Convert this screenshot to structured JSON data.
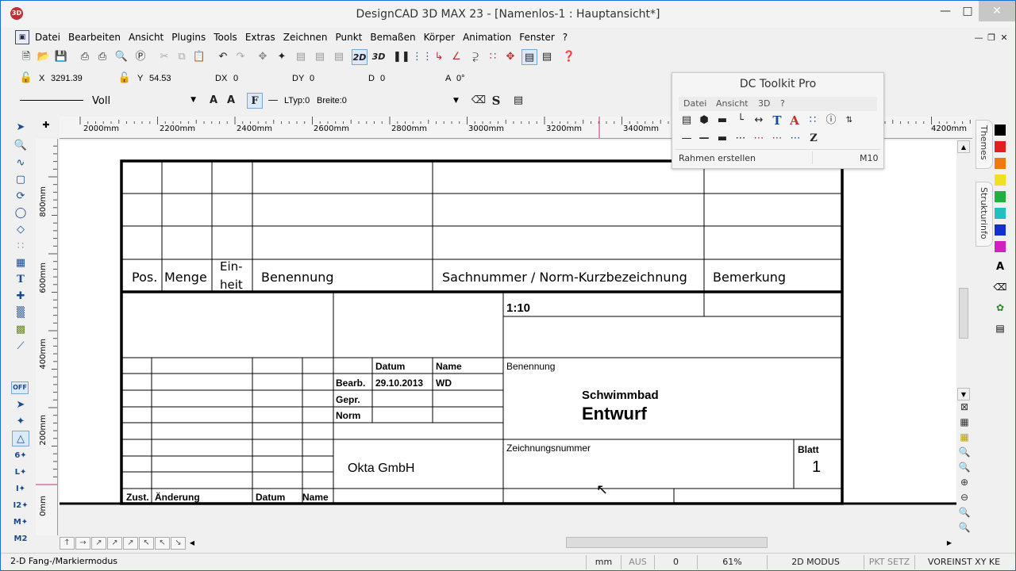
{
  "window": {
    "title": "DesignCAD 3D MAX 23 - [Namenlos-1 : Hauptansicht*]",
    "app_icon": "3D"
  },
  "menu": [
    "Datei",
    "Bearbeiten",
    "Ansicht",
    "Plugins",
    "Tools",
    "Extras",
    "Zeichnen",
    "Punkt",
    "Bemaßen",
    "Körper",
    "Animation",
    "Fenster",
    "?"
  ],
  "toolbar": {
    "btn_2d": "2D",
    "btn_3d": "3D"
  },
  "coords": {
    "x_label": "X",
    "x_value": "3291.39",
    "y_label": "Y",
    "y_value": "54.53",
    "dx_label": "DX",
    "dx_value": "0",
    "dy_label": "DY",
    "dy_value": "0",
    "d_label": "D",
    "d_value": "0",
    "a_label": "A",
    "a_value": "0°"
  },
  "linebar": {
    "line_style": "Voll",
    "font_btn": "F",
    "ltyp": "LTyp:0",
    "breite": "Breite:0"
  },
  "ruler_h": [
    "2000mm",
    "2200mm",
    "2400mm",
    "2600mm",
    "2800mm",
    "3000mm",
    "3200mm",
    "3400mm",
    "4200mm"
  ],
  "ruler_v": [
    "800mm",
    "600mm",
    "400mm",
    "200mm",
    "0mm"
  ],
  "drawing": {
    "parts_headers": {
      "pos": "Pos.",
      "menge": "Menge",
      "einheit_1": "Ein-",
      "einheit_2": "heit",
      "benennung": "Benennung",
      "sachnummer": "Sachnummer / Norm-Kurzbezeichnung",
      "bemerkung": "Bemerkung"
    },
    "scale": "1:10",
    "col_datum": "Datum",
    "col_name": "Name",
    "row_bearb": "Bearb.",
    "bearb_date": "29.10.2013",
    "bearb_name": "WD",
    "row_gepr": "Gepr.",
    "row_norm": "Norm",
    "benennung_label": "Benennung",
    "title_line1": "Schwimmbad",
    "title_line2": "Entwurf",
    "company": "Okta GmbH",
    "zeichnungsnummer": "Zeichnungsnummer",
    "blatt_label": "Blatt",
    "blatt_value": "1",
    "rev_zust": "Zust.",
    "rev_aenderung": "Änderung",
    "rev_datum": "Datum",
    "rev_name": "Name"
  },
  "dctoolkit": {
    "title": "DC Toolkit Pro",
    "menu": [
      "Datei",
      "Ansicht",
      "3D",
      "?"
    ],
    "status_text": "Rahmen erstellen",
    "status_code": "M10"
  },
  "side_tabs": {
    "themes": "Themes",
    "strukturinfo": "Strukturinfo"
  },
  "colors": [
    "#000000",
    "#e02020",
    "#f07a10",
    "#f0e020",
    "#20b040",
    "#20c0c0",
    "#1030d0",
    "#d020c0"
  ],
  "left_tools": {
    "off_label": "OFF"
  },
  "statusbar": {
    "mode_text": "2-D Fang-/Markiermodus",
    "unit": "mm",
    "aus": "AUS",
    "zero": "0",
    "zoom": "61%",
    "mode2d": "2D MODUS",
    "pkt_setz": "PKT SETZ",
    "voreinst": "VOREINST XY KE"
  }
}
